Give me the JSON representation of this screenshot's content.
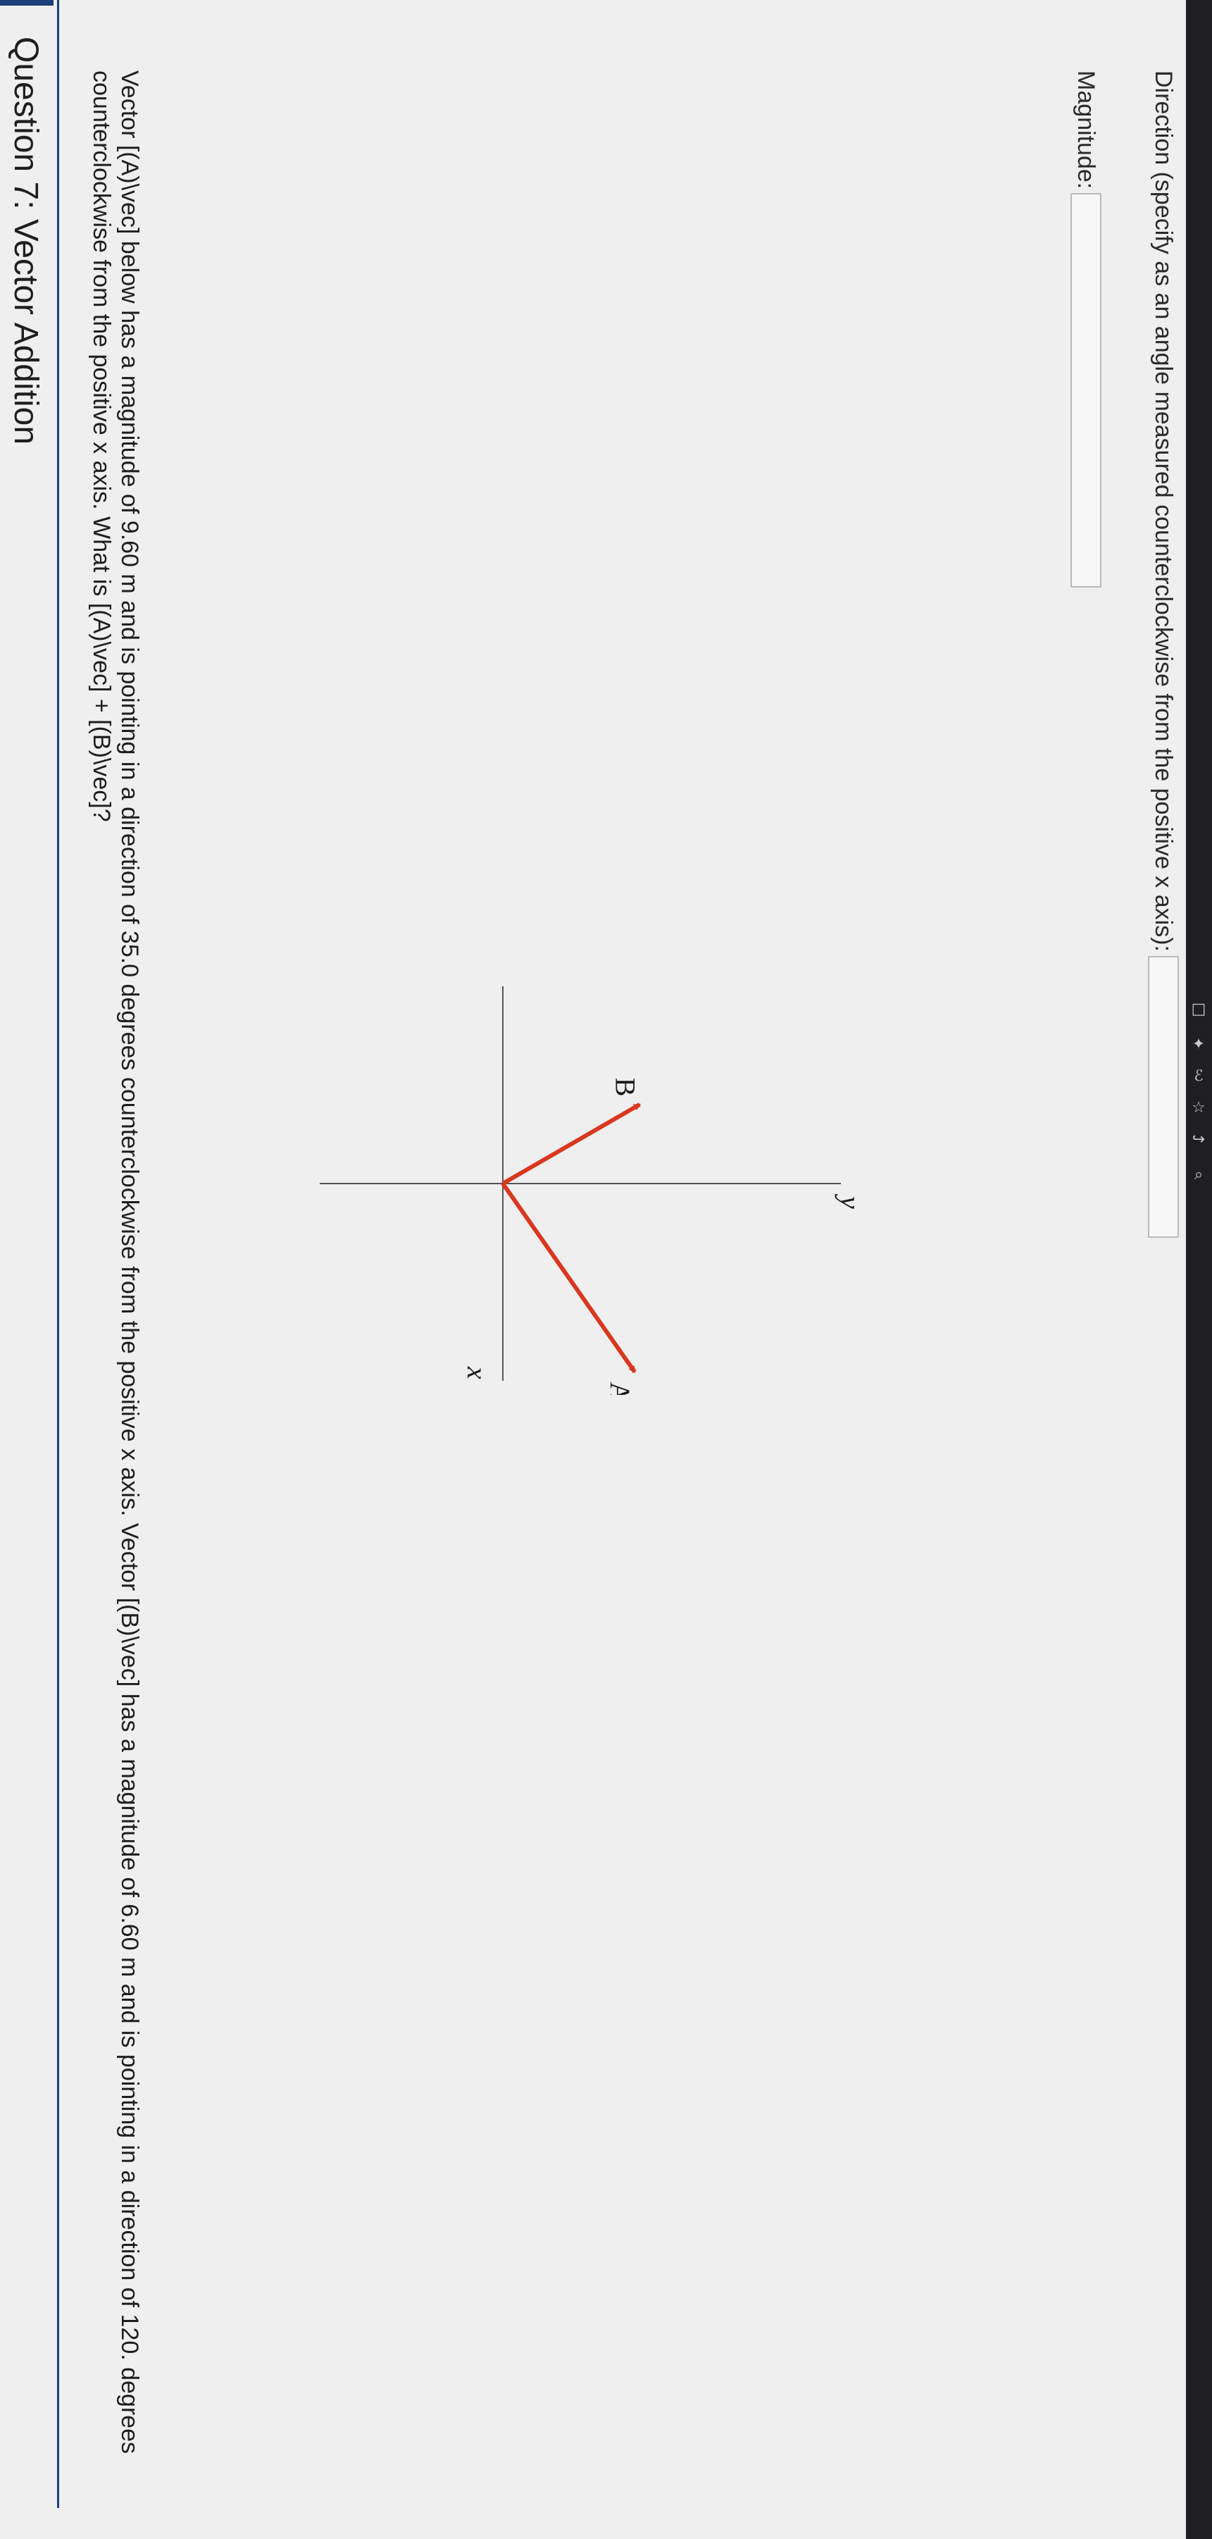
{
  "browser": {
    "icons": [
      "search-icon",
      "share-icon",
      "star-icon",
      "profile-icon",
      "puzzle-icon",
      "window-icon"
    ]
  },
  "question": {
    "title": "Question 7: Vector Addition",
    "text": "Vector [(A)\\vec] below has a magnitude of 9.60 m and is pointing in a direction of 35.0 degrees counterclockwise from the positive x axis. Vector [(B)\\vec] has a magnitude of 6.60 m and is pointing in a direction of 120. degrees counterclockwise from the positive x axis. What is [(A)\\vec] + [(B)\\vec]?"
  },
  "diagram": {
    "x_axis_label": "x",
    "y_axis_label": "y",
    "vectors": [
      {
        "label": "A",
        "magnitude_m": 9.6,
        "direction_deg": 35.0,
        "color": "#d9381e"
      },
      {
        "label": "B",
        "magnitude_m": 6.6,
        "direction_deg": 120.0,
        "color": "#d9381e"
      }
    ],
    "axis_color": "#555555"
  },
  "answers": {
    "magnitude_label": "Magnitude:",
    "magnitude_value": "",
    "direction_label": "Direction (specify as an angle measured counterclockwise from the positive x axis):",
    "direction_value": ""
  },
  "colors": {
    "accent": "#1d3f7a",
    "vector": "#d9381e",
    "background": "#efefef",
    "toolbar": "#1f1f22"
  }
}
